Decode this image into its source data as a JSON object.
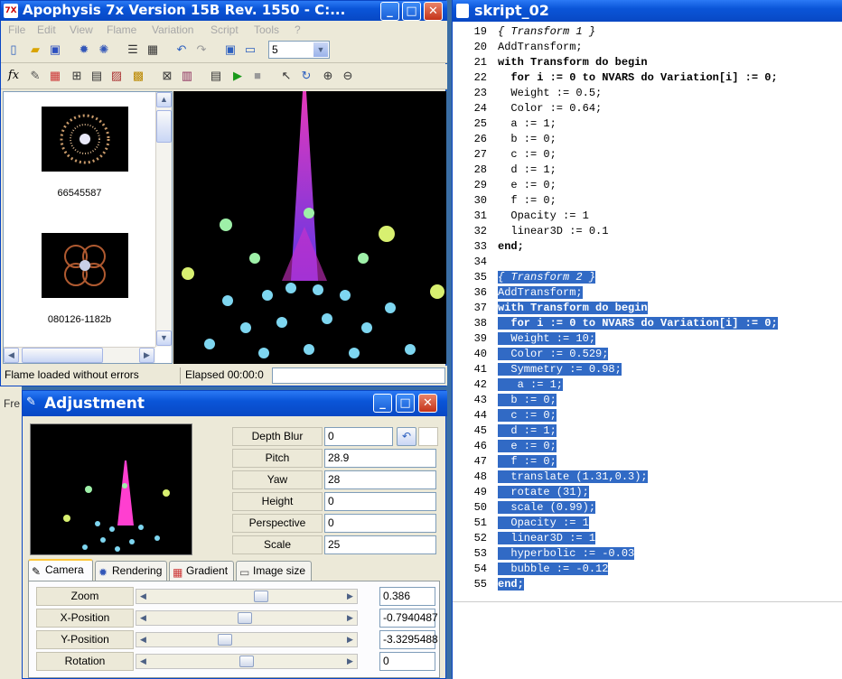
{
  "apophysis": {
    "title": "Apophysis 7x Version 15B Rev. 1550 - C:...",
    "menu": [
      "File",
      "Edit",
      "View",
      "Flame",
      "Variation",
      "Script",
      "Tools",
      "?"
    ],
    "zoom_combo": "5",
    "thumbnails": [
      {
        "label": "66545587"
      },
      {
        "label": "080126-1182b"
      }
    ],
    "status": {
      "message": "Flame loaded without errors",
      "elapsed": "Elapsed 00:00:0"
    }
  },
  "side_fragment": "Fre",
  "adjustment": {
    "title": "Adjustment",
    "params": [
      {
        "label": "Depth Blur",
        "value": "0"
      },
      {
        "label": "Pitch",
        "value": "28.9"
      },
      {
        "label": "Yaw",
        "value": "28"
      },
      {
        "label": "Height",
        "value": "0"
      },
      {
        "label": "Perspective",
        "value": "0"
      },
      {
        "label": "Scale",
        "value": "25"
      }
    ],
    "tabs": [
      "Camera",
      "Rendering",
      "Gradient",
      "Image size"
    ],
    "camera": [
      {
        "label": "Zoom",
        "value": "0.386",
        "level": 0.58
      },
      {
        "label": "X-Position",
        "value": "-0.7940487",
        "level": 0.49
      },
      {
        "label": "Y-Position",
        "value": "-3.3295488",
        "level": 0.38
      },
      {
        "label": "Rotation",
        "value": "0",
        "level": 0.5
      }
    ]
  },
  "script": {
    "title": "skript_02",
    "lines": [
      {
        "n": "19",
        "t": "{ Transform 1 }",
        "hl": false
      },
      {
        "n": "20",
        "t": "AddTransform;",
        "hl": false
      },
      {
        "n": "21",
        "t": "with Transform do begin",
        "hl": false
      },
      {
        "n": "22",
        "t": "  for i := 0 to NVARS do Variation[i] := 0;",
        "hl": false
      },
      {
        "n": "23",
        "t": "  Weight := 0.5;",
        "hl": false
      },
      {
        "n": "24",
        "t": "  Color := 0.64;",
        "hl": false
      },
      {
        "n": "25",
        "t": "  a := 1;",
        "hl": false
      },
      {
        "n": "26",
        "t": "  b := 0;",
        "hl": false
      },
      {
        "n": "27",
        "t": "  c := 0;",
        "hl": false
      },
      {
        "n": "28",
        "t": "  d := 1;",
        "hl": false
      },
      {
        "n": "29",
        "t": "  e := 0;",
        "hl": false
      },
      {
        "n": "30",
        "t": "  f := 0;",
        "hl": false
      },
      {
        "n": "31",
        "t": "  Opacity := 1",
        "hl": false
      },
      {
        "n": "32",
        "t": "  linear3D := 0.1",
        "hl": false
      },
      {
        "n": "33",
        "t": "end;",
        "hl": false
      },
      {
        "n": "34",
        "t": "",
        "hl": false
      },
      {
        "n": "35",
        "t": "{ Transform 2 }",
        "hl": true
      },
      {
        "n": "36",
        "t": "AddTransform;",
        "hl": true
      },
      {
        "n": "37",
        "t": "with Transform do begin",
        "hl": true
      },
      {
        "n": "38",
        "t": "  for i := 0 to NVARS do Variation[i] := 0;",
        "hl": true
      },
      {
        "n": "39",
        "t": "  Weight := 10;",
        "hl": true
      },
      {
        "n": "40",
        "t": "  Color := 0.529;",
        "hl": true
      },
      {
        "n": "41",
        "t": "  Symmetry := 0.98;",
        "hl": true
      },
      {
        "n": "42",
        "t": "   a := 1;",
        "hl": true
      },
      {
        "n": "43",
        "t": "  b := 0;",
        "hl": true
      },
      {
        "n": "44",
        "t": "  c := 0;",
        "hl": true
      },
      {
        "n": "45",
        "t": "  d := 1;",
        "hl": true
      },
      {
        "n": "46",
        "t": "  e := 0;",
        "hl": true
      },
      {
        "n": "47",
        "t": "  f := 0;",
        "hl": true
      },
      {
        "n": "48",
        "t": "  translate (1.31,0.3);",
        "hl": true
      },
      {
        "n": "49",
        "t": "  rotate (31);",
        "hl": true
      },
      {
        "n": "50",
        "t": "  scale (0.99);",
        "hl": true
      },
      {
        "n": "51",
        "t": "  Opacity := 1",
        "hl": true
      },
      {
        "n": "52",
        "t": "  linear3D := 1",
        "hl": true
      },
      {
        "n": "53",
        "t": "  hyperbolic := -0.03",
        "hl": true
      },
      {
        "n": "54",
        "t": "  bubble := -0.12",
        "hl": true
      },
      {
        "n": "55",
        "t": "end;",
        "hl": true
      }
    ]
  },
  "colors": {
    "titlebar": "#0a55d8",
    "selection": "#316ac5",
    "window_bg": "#ece9d8"
  }
}
